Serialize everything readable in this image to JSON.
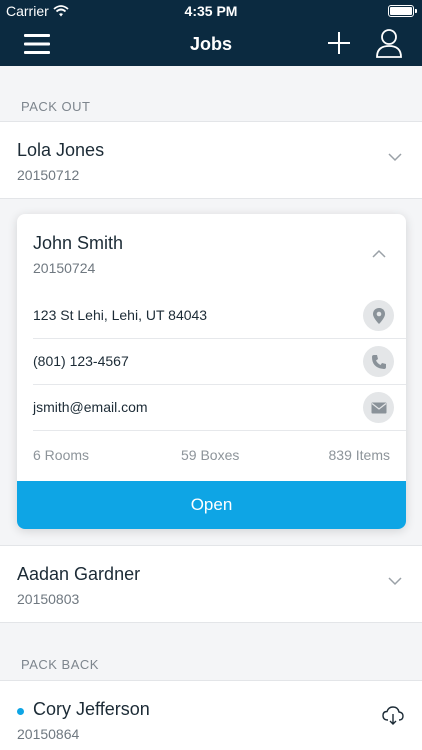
{
  "status_bar": {
    "carrier": "Carrier",
    "time": "4:35 PM"
  },
  "nav": {
    "title": "Jobs",
    "menu_icon": "hamburger-menu-icon",
    "add_icon": "plus-icon",
    "profile_icon": "user-profile-icon"
  },
  "sections": [
    {
      "header": "PACK OUT",
      "jobs": [
        {
          "name": "Lola Jones",
          "number": "20150712",
          "expanded": false
        },
        {
          "name": "John Smith",
          "number": "20150724",
          "expanded": true,
          "address": "123 St Lehi, Lehi, UT 84043",
          "phone": "(801) 123-4567",
          "email": "jsmith@email.com",
          "rooms": "6 Rooms",
          "boxes": "59 Boxes",
          "items": "839 Items",
          "open_label": "Open"
        },
        {
          "name": "Aadan Gardner",
          "number": "20150803",
          "expanded": false
        }
      ]
    },
    {
      "header": "PACK BACK",
      "jobs": [
        {
          "name": "Cory Jefferson",
          "number": "20150864",
          "unread": true,
          "download_icon": "cloud-download-icon"
        }
      ]
    }
  ],
  "colors": {
    "nav_bg": "#0b2a40",
    "accent": "#0ea5e5",
    "background": "#f4f5f7"
  }
}
